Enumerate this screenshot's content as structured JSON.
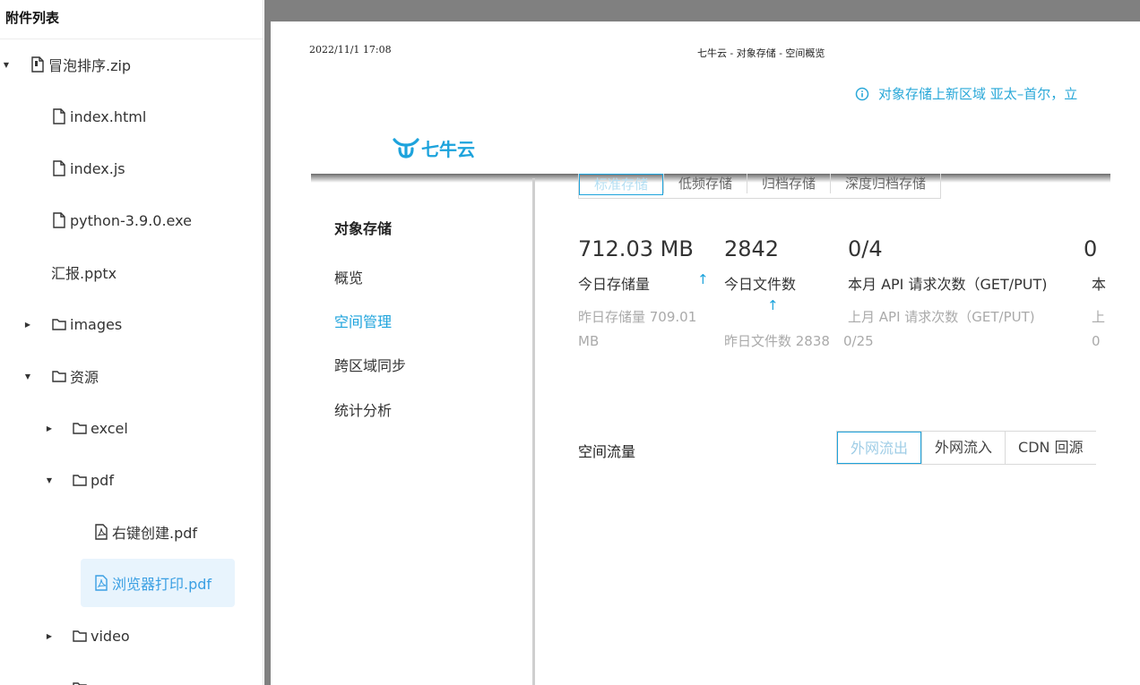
{
  "sidebar": {
    "title": "附件列表",
    "items": [
      {
        "label": "冒泡排序.zip",
        "icon": "file-icon"
      },
      {
        "label": "index.html",
        "icon": "file-icon"
      },
      {
        "label": "index.js",
        "icon": "file-icon"
      },
      {
        "label": "python-3.9.0.exe",
        "icon": "file-icon"
      },
      {
        "label": "汇报.pptx",
        "icon": ""
      },
      {
        "label": "images",
        "icon": "folder-icon"
      },
      {
        "label": "资源",
        "icon": "folder-icon"
      },
      {
        "label": "excel",
        "icon": "folder-icon"
      },
      {
        "label": "pdf",
        "icon": "folder-icon"
      },
      {
        "label": "右键创建.pdf",
        "icon": "pdf-icon"
      },
      {
        "label": "浏览器打印.pdf",
        "icon": "pdf-icon",
        "selected": true
      },
      {
        "label": "video",
        "icon": "folder-icon"
      }
    ]
  },
  "document": {
    "print_date": "2022/11/1 17:08",
    "print_title": "七牛云 - 对象存储 - 空间概览",
    "notice": "对象存储上新区域 亚太–首尔，立",
    "logo_text": "七牛云",
    "nav": {
      "heading": "对象存储",
      "items": [
        "概览",
        "空间管理",
        "跨区域同步",
        "统计分析"
      ],
      "active": "空间管理"
    },
    "storage_tabs": [
      "标准存储",
      "低频存储",
      "归档存储",
      "深度归档存储"
    ],
    "stats": [
      {
        "value": "712.03 MB",
        "label": "今日存储量",
        "sub1": "昨日存储量 709.01",
        "sub2": "MB"
      },
      {
        "value": "2842",
        "label": "今日文件数",
        "sub1": "",
        "sub2": "昨日文件数 2838"
      },
      {
        "value": "0/4",
        "label": "本月 API 请求次数（GET/PUT)",
        "sub1": "上月 API 请求次数（GET/PUT)",
        "sub2": "0/25"
      },
      {
        "value": "0",
        "label": "本",
        "sub1": "上",
        "sub2": "0"
      }
    ],
    "traffic": {
      "title": "空间流量",
      "tabs": [
        "外网流出",
        "外网流入",
        "CDN 回源"
      ],
      "active": "外网流出"
    }
  },
  "colors": {
    "accent": "#1da3dc",
    "viewer_bg": "#808080",
    "selected_bg": "#e8f4fd"
  }
}
